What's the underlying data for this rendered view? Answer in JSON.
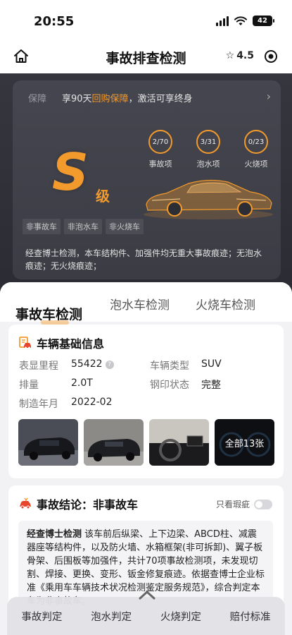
{
  "status": {
    "time": "20:55",
    "battery": "42"
  },
  "nav": {
    "title": "事故排查检测",
    "rating": "4.5"
  },
  "hero": {
    "guarantee_tag": "保障",
    "guarantee_prefix": "享90天",
    "guarantee_highlight": "回购保障",
    "guarantee_suffix": "，激活可享终身",
    "grade": "S",
    "grade_unit": "级",
    "stats": [
      {
        "value": "2/70",
        "label": "事故项"
      },
      {
        "value": "3/31",
        "label": "泡水项"
      },
      {
        "value": "0/23",
        "label": "火烧项"
      }
    ],
    "tags": [
      "非事故车",
      "非泡水车",
      "非火烧车"
    ],
    "description": "经查博士检测，本车结构件、加强件均无重大事故痕迹；无泡水痕迹；无火烧痕迹；"
  },
  "tabs": [
    {
      "label": "事故车检测",
      "active": true
    },
    {
      "label": "泡水车检测",
      "active": false
    },
    {
      "label": "火烧车检测",
      "active": false
    }
  ],
  "vehicle_info": {
    "title": "车辆基础信息",
    "rows": [
      {
        "label": "表显里程",
        "value": "55422",
        "label2": "车辆类型",
        "value2": "SUV"
      },
      {
        "label": "排量",
        "value": "2.0T",
        "label2": "钢印状态",
        "value2": "完整"
      },
      {
        "label": "制造年月",
        "value": "2022-02"
      }
    ],
    "photos_all_label": "全部13张"
  },
  "conclusion": {
    "title": "事故结论：非事故车",
    "only_flaws_label": "只看瑕疵",
    "body_lead": "经查博士检测",
    "body_text": "该车前后纵梁、上下边梁、ABCD柱、减震器座等结构件，以及防火墙、水箱框架(非可拆卸)、翼子板骨架、后围板等加强件，共计70项事故检测项，未发现切割、焊接、更换、变形、钣金修复痕迹。依据查博士企业标准《乘用车车辆技术状况检测鉴定服务规范》，综合判定本车为非事故车。"
  },
  "bottom_tabs": [
    "事故判定",
    "泡水判定",
    "火烧判定",
    "赔付标准"
  ],
  "colors": {
    "accent": "#f39a2c",
    "hero_bg": "#35363e"
  }
}
